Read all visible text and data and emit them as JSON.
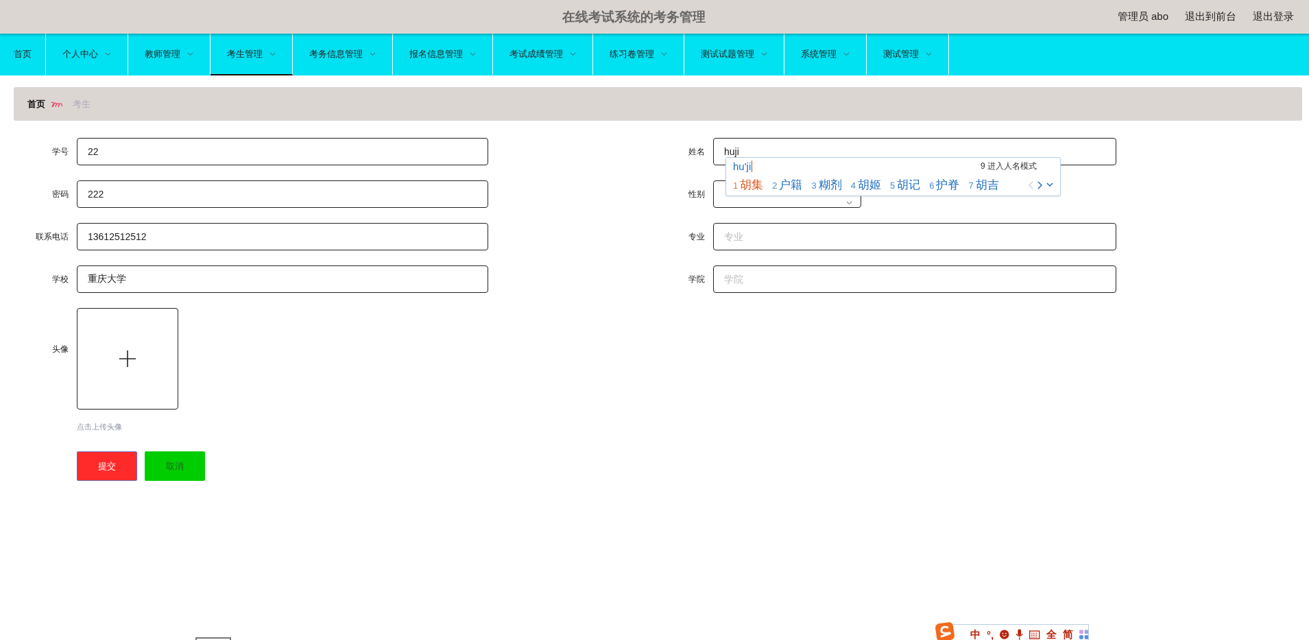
{
  "header": {
    "title": "在线考试系统的考务管理",
    "user": "管理员 abo",
    "links": [
      "退出到前台",
      "退出登录"
    ]
  },
  "nav": [
    {
      "label": "首页",
      "dropdown": false,
      "selected": false
    },
    {
      "label": "个人中心",
      "dropdown": true,
      "selected": false
    },
    {
      "label": "教师管理",
      "dropdown": true,
      "selected": false
    },
    {
      "label": "考生管理",
      "dropdown": true,
      "selected": true
    },
    {
      "label": "考务信息管理",
      "dropdown": true,
      "selected": false
    },
    {
      "label": "报名信息管理",
      "dropdown": true,
      "selected": false
    },
    {
      "label": "考试成绩管理",
      "dropdown": true,
      "selected": false
    },
    {
      "label": "练习卷管理",
      "dropdown": true,
      "selected": false
    },
    {
      "label": "测试试题管理",
      "dropdown": true,
      "selected": false
    },
    {
      "label": "系统管理",
      "dropdown": true,
      "selected": false
    },
    {
      "label": "测试管理",
      "dropdown": true,
      "selected": false
    }
  ],
  "breadcrumb": {
    "home": "首页",
    "current": "考生"
  },
  "form": {
    "left": [
      {
        "kind": "text",
        "label": "学号",
        "value": "22"
      },
      {
        "kind": "text",
        "label": "密码",
        "value": "222"
      },
      {
        "kind": "text",
        "label": "联系电话",
        "value": "13612512512"
      },
      {
        "kind": "text",
        "label": "学校",
        "value": "重庆大学"
      },
      {
        "kind": "upload",
        "label": "头像",
        "hint": "点击上传头像"
      }
    ],
    "right": [
      {
        "kind": "text",
        "label": "姓名",
        "value": "huji"
      },
      {
        "kind": "select",
        "label": "性别"
      },
      {
        "kind": "text",
        "label": "专业",
        "placeholder": "专业"
      },
      {
        "kind": "text",
        "label": "学院",
        "placeholder": "学院"
      }
    ],
    "buttons": [
      {
        "label": "提交",
        "kind": "primary"
      },
      {
        "label": "取消",
        "kind": "cancel"
      }
    ]
  },
  "ime_popup": {
    "composition": "hu'ji",
    "mode_hint": "9 进入人名模式",
    "candidates": [
      {
        "index": "1",
        "text": "胡集",
        "selected": true
      },
      {
        "index": "2",
        "text": "户籍",
        "selected": false
      },
      {
        "index": "3",
        "text": "糊剂",
        "selected": false
      },
      {
        "index": "4",
        "text": "胡姬",
        "selected": false
      },
      {
        "index": "5",
        "text": "胡记",
        "selected": false
      },
      {
        "index": "6",
        "text": "护脊",
        "selected": false
      },
      {
        "index": "7",
        "text": "胡吉",
        "selected": false
      }
    ]
  },
  "ime_toolbar": {
    "mode": "中",
    "punctuation": "°,",
    "width": "全",
    "script": "简"
  }
}
